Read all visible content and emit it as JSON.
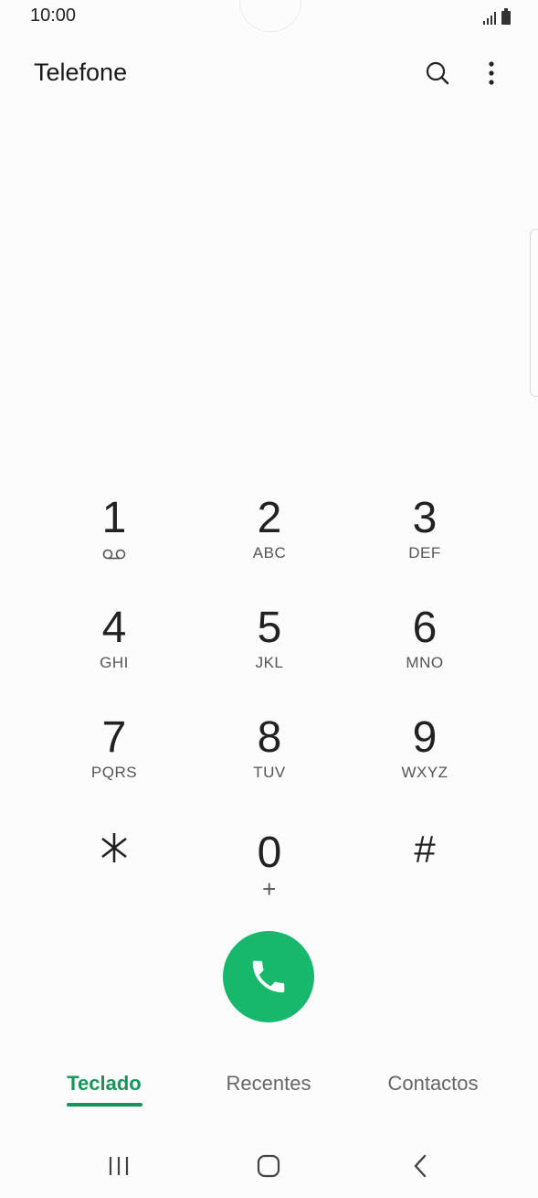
{
  "status_bar": {
    "time": "10:00"
  },
  "app_bar": {
    "title": "Telefone",
    "search_icon": "search-icon",
    "more_icon": "more-vert-icon"
  },
  "dialpad": {
    "keys": [
      {
        "digit": "1",
        "sub": "",
        "icon": "voicemail-icon"
      },
      {
        "digit": "2",
        "sub": "ABC"
      },
      {
        "digit": "3",
        "sub": "DEF"
      },
      {
        "digit": "4",
        "sub": "GHI"
      },
      {
        "digit": "5",
        "sub": "JKL"
      },
      {
        "digit": "6",
        "sub": "MNO"
      },
      {
        "digit": "7",
        "sub": "PQRS"
      },
      {
        "digit": "8",
        "sub": "TUV"
      },
      {
        "digit": "9",
        "sub": "WXYZ"
      },
      {
        "digit": "*",
        "sub": ""
      },
      {
        "digit": "0",
        "sub": "+"
      },
      {
        "digit": "#",
        "sub": ""
      }
    ]
  },
  "call": {
    "icon": "phone-icon",
    "color": "#17b86b"
  },
  "tabs": [
    {
      "label": "Teclado",
      "active": true
    },
    {
      "label": "Recentes",
      "active": false
    },
    {
      "label": "Contactos",
      "active": false
    }
  ],
  "theme": {
    "accent": "#16965a"
  },
  "nav": {
    "recents_icon": "recent-apps-icon",
    "home_icon": "home-icon",
    "back_icon": "back-icon"
  }
}
